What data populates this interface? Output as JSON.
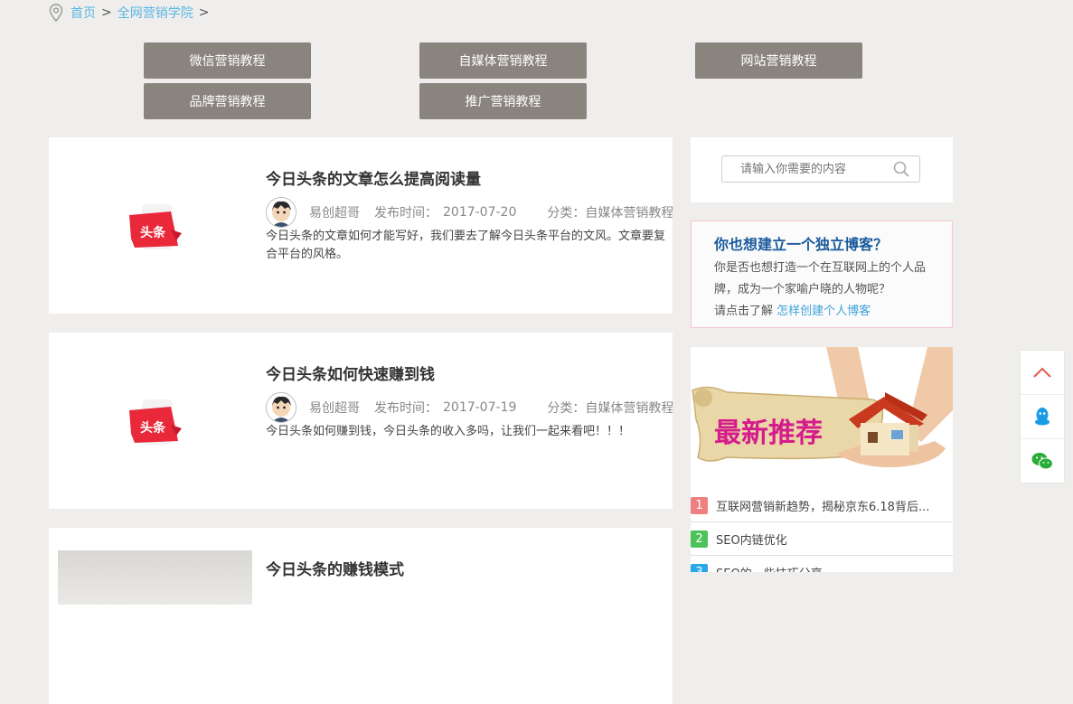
{
  "breadcrumb": {
    "home": "首页",
    "section": "全网营销学院",
    "separator": ">"
  },
  "categories": [
    "微信营销教程",
    "自媒体营销教程",
    "网站营销教程",
    "品牌营销教程",
    "推广营销教程"
  ],
  "articles": [
    {
      "title": "今日头条的文章怎么提高阅读量",
      "author": "易创超哥",
      "date_label": "发布时间：",
      "date": "2017-07-20",
      "category": "分类：自媒体营销教程",
      "summary": "今日头条的文章如何才能写好，我们要去了解今日头条平台的文风。文章要复合平台的风格。",
      "thumb_text": "头条"
    },
    {
      "title": "今日头条如何快速赚到钱",
      "author": "易创超哥",
      "date_label": "发布时间：",
      "date": "2017-07-19",
      "category": "分类：自媒体营销教程",
      "summary": "今日头条如何赚到钱，今日头条的收入多吗，让我们一起来看吧！！！",
      "thumb_text": "头条"
    },
    {
      "title": "今日头条的赚钱模式"
    }
  ],
  "search": {
    "placeholder": "请输入你需要的内容"
  },
  "promo": {
    "title": "你也想建立一个独立博客？",
    "text": "你是否也想打造一个在互联网上的个人品牌，成为一个家喻户晓的人物呢？",
    "link_prefix": "请点击了解",
    "link": "怎样创建个人博客"
  },
  "recommend": {
    "banner_text": "最新推荐",
    "items": [
      {
        "num": "1",
        "text": "互联网营销新趋势，揭秘京东6.18背后...",
        "color": "#f08080"
      },
      {
        "num": "2",
        "text": "SEO内链优化",
        "color": "#4cc35a"
      },
      {
        "num": "3",
        "text": "SEO的一些技巧分享",
        "color": "#2aa7e6"
      }
    ]
  },
  "float_tools": [
    "back-to-top",
    "qq",
    "wechat"
  ],
  "colors": {
    "accent": "#5bb7e5",
    "button": "#8a847e",
    "promo_title": "#1a5a9c",
    "background": "#efeeec"
  }
}
